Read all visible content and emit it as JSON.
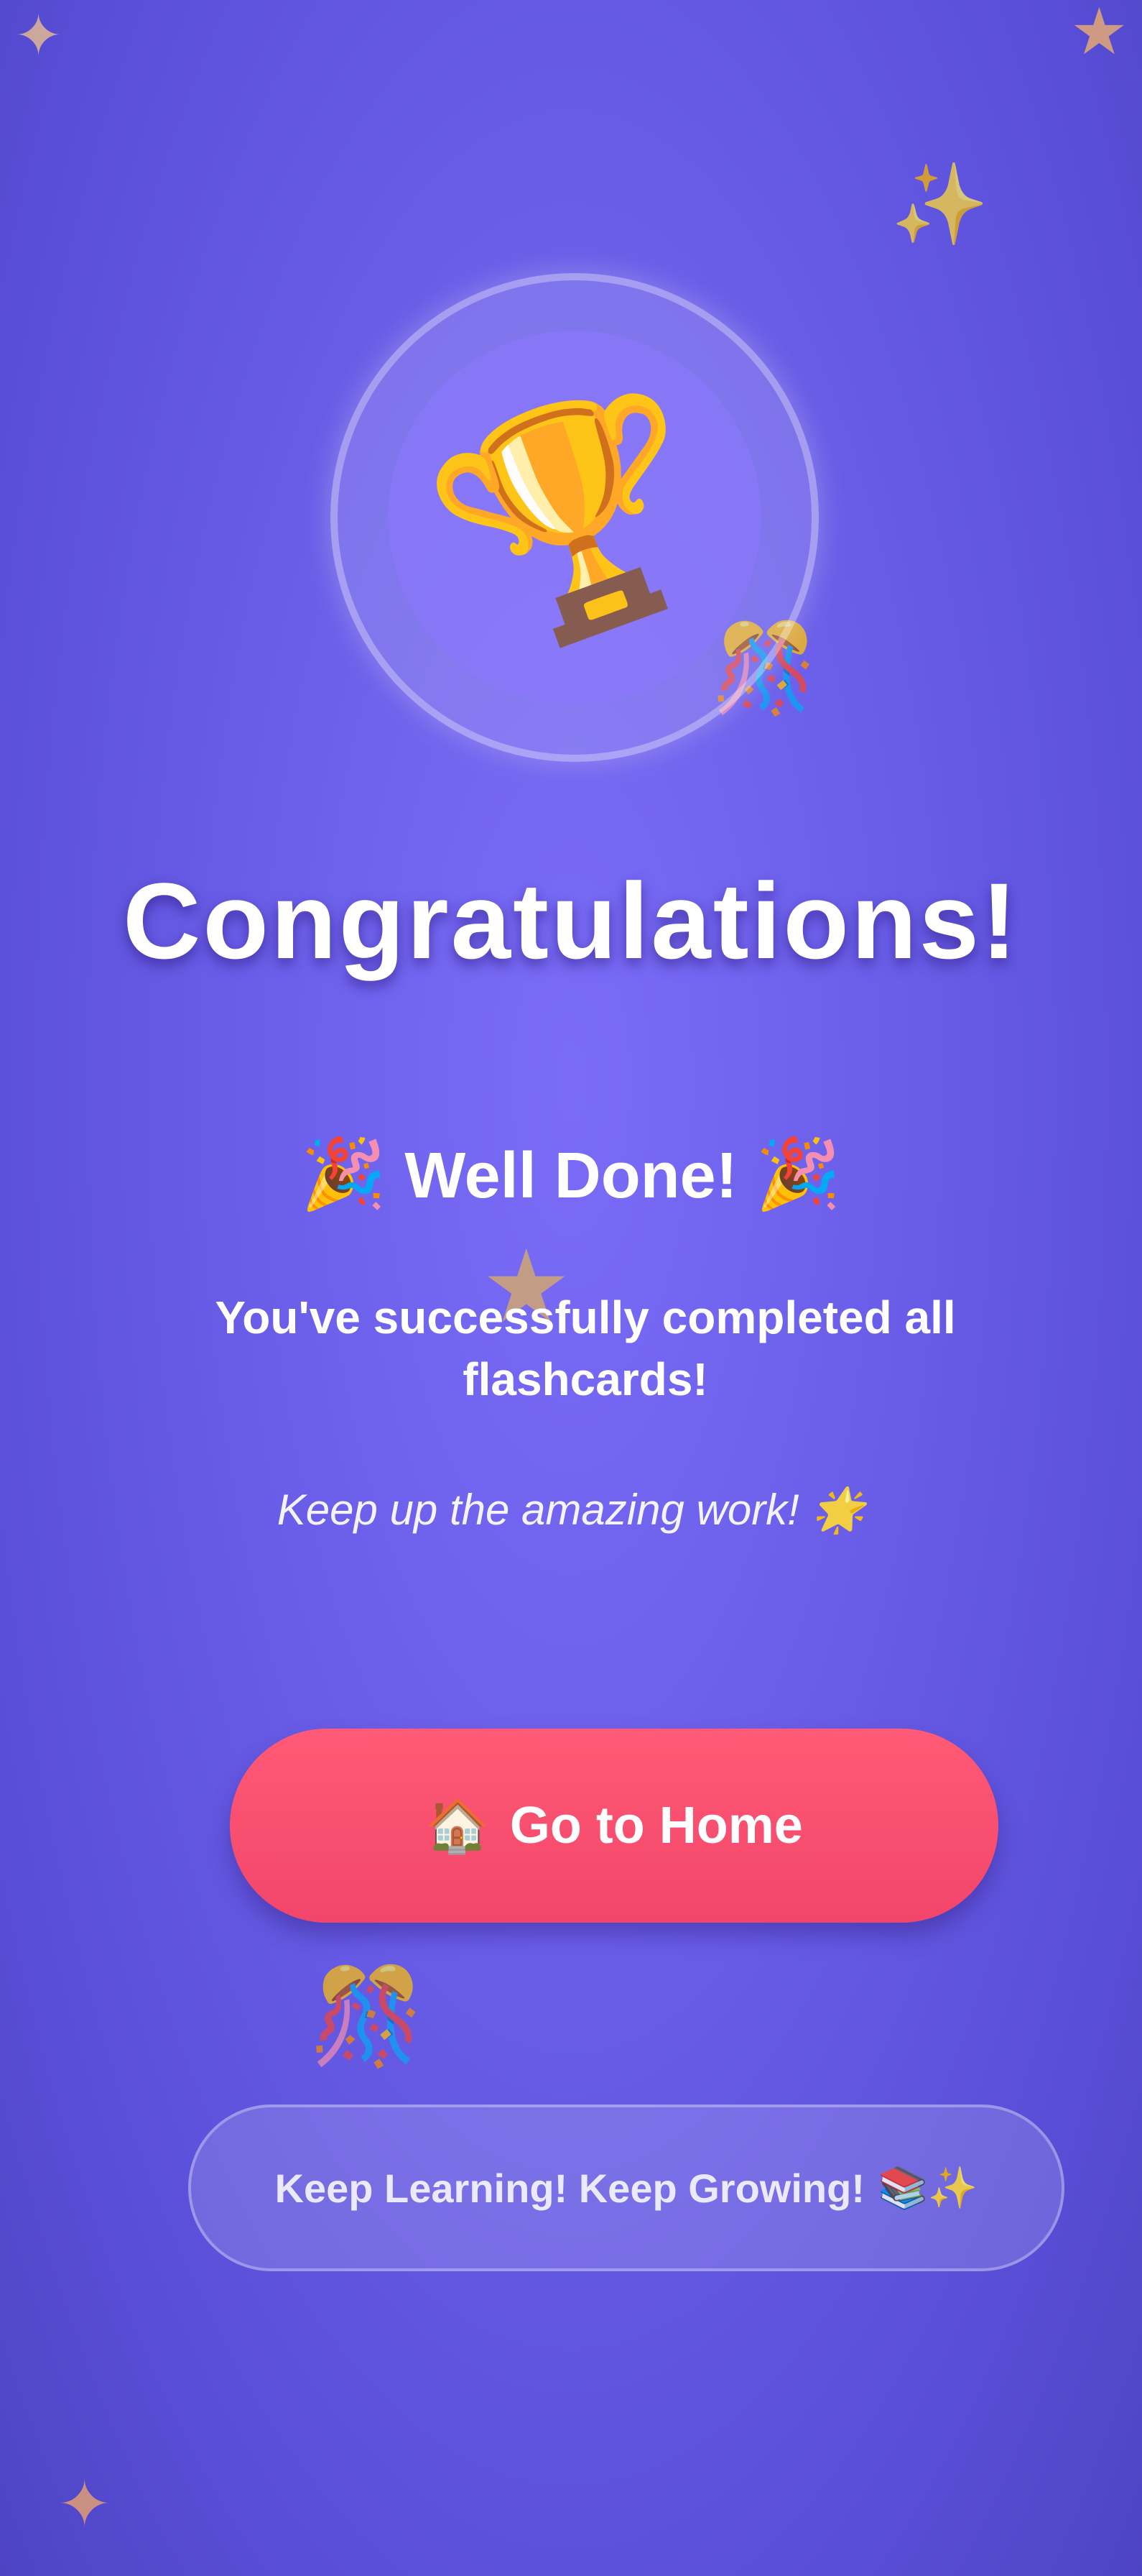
{
  "celebration": {
    "icon": "trophy-icon",
    "title": "Congratulations!",
    "heading": {
      "emoji_left": "🎉",
      "text": "Well Done!",
      "emoji_right": "🎉"
    },
    "message": "You've successfully completed all flashcards!",
    "sub_message": "Keep up the amazing work! 🌟"
  },
  "home_button": {
    "icon": "🏠",
    "label": "Go to Home"
  },
  "footer": {
    "text": "Keep Learning! Keep Growing!",
    "emoji": "📚✨"
  },
  "colors": {
    "background": "#6a5ee8",
    "button": "#f2456a",
    "text": "#ffffff"
  }
}
